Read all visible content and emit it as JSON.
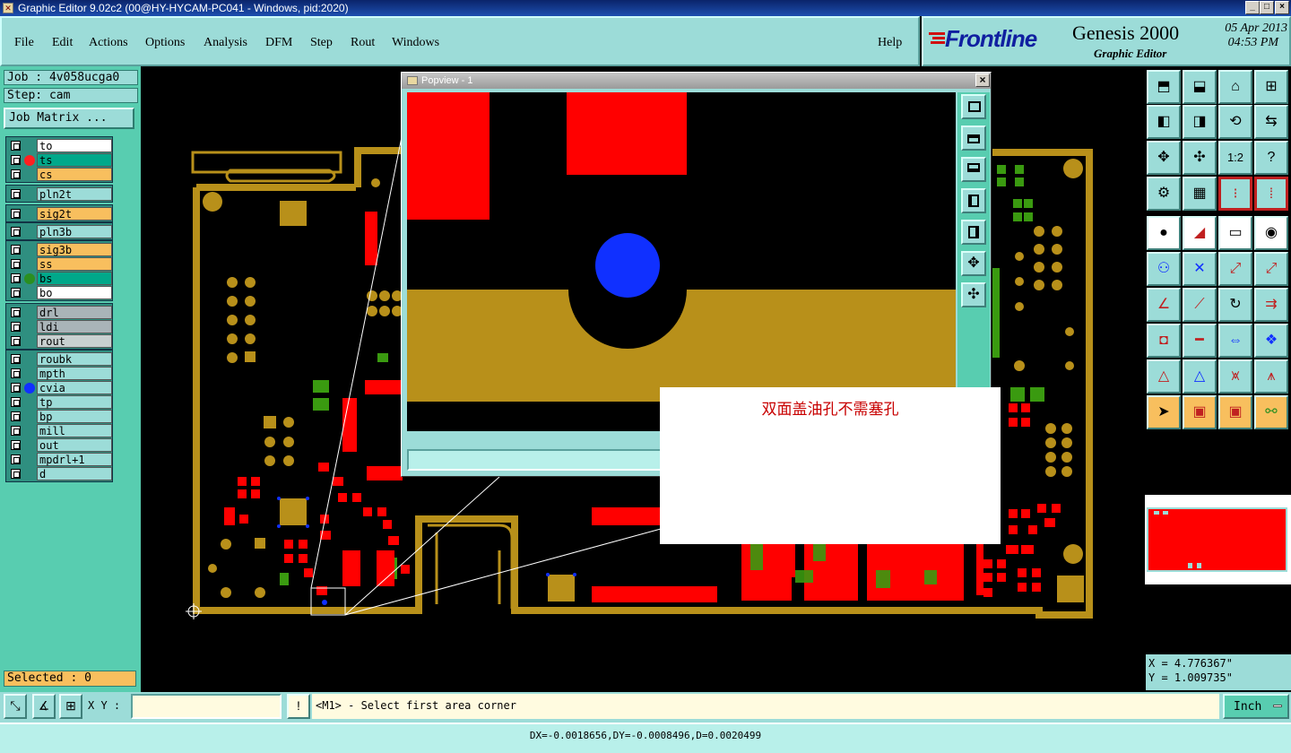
{
  "window": {
    "title": "Graphic Editor 9.02c2 (00@HY-HYCAM-PC041 - Windows, pid:2020)",
    "buttons": [
      "_",
      "□",
      "×"
    ]
  },
  "menu": {
    "items": [
      "File",
      "Edit",
      "Actions",
      "Options",
      "Analysis",
      "DFM",
      "Step",
      "Rout",
      "Windows"
    ],
    "help": "Help"
  },
  "brand": {
    "logo": "Frontline",
    "product": "Genesis 2000",
    "subtitle": "Graphic Editor",
    "date": "05 Apr 2013",
    "time": "04:53 PM"
  },
  "job": {
    "job_label": "Job : 4v058ucga0",
    "step_label": "Step: cam",
    "matrix_button": "Job Matrix ..."
  },
  "layers": [
    {
      "name": "to",
      "bg": "#ffffff",
      "dot": ""
    },
    {
      "name": "ts",
      "bg": "#00a88a",
      "dot": "#ff2020"
    },
    {
      "name": "cs",
      "bg": "#f8bf5e",
      "dot": ""
    },
    {
      "name": "pln2t",
      "bg": "#9cdcd8",
      "dot": ""
    },
    {
      "name": "sig2t",
      "bg": "#f8bf5e",
      "dot": ""
    },
    {
      "name": "pln3b",
      "bg": "#9cdcd8",
      "dot": ""
    },
    {
      "name": "sig3b",
      "bg": "#f8bf5e",
      "dot": ""
    },
    {
      "name": "ss",
      "bg": "#f8bf5e",
      "dot": ""
    },
    {
      "name": "bs",
      "bg": "#00a88a",
      "dot": "#2a8f20"
    },
    {
      "name": "bo",
      "bg": "#ffffff",
      "dot": ""
    },
    {
      "name": "drl",
      "bg": "#a9b4b8",
      "dot": ""
    },
    {
      "name": "ldi",
      "bg": "#a9b4b8",
      "dot": ""
    },
    {
      "name": "rout",
      "bg": "#c8d0d0",
      "dot": ""
    },
    {
      "name": "roubk",
      "bg": "#9cdcd8",
      "dot": ""
    },
    {
      "name": "mpth",
      "bg": "#9cdcd8",
      "dot": ""
    },
    {
      "name": "cvia",
      "bg": "#9cdcd8",
      "dot": "#1030ff"
    },
    {
      "name": "tp",
      "bg": "#9cdcd8",
      "dot": ""
    },
    {
      "name": "bp",
      "bg": "#9cdcd8",
      "dot": ""
    },
    {
      "name": "mill",
      "bg": "#9cdcd8",
      "dot": ""
    },
    {
      "name": "out",
      "bg": "#9cdcd8",
      "dot": ""
    },
    {
      "name": "mpdrl+1",
      "bg": "#9cdcd8",
      "dot": ""
    },
    {
      "name": "d",
      "bg": "#9cdcd8",
      "dot": ""
    }
  ],
  "selected": "Selected : 0",
  "popview": {
    "title": "Popview - 1"
  },
  "annotation": "双面盖油孔不需塞孔",
  "coords": {
    "x": "X = 4.776367\"",
    "y": "Y = 1.009735\""
  },
  "bottom": {
    "xy_label": "X Y :",
    "xy_value": "",
    "prompt": "<M1> - Select first area corner",
    "units": "Inch"
  },
  "status": "DX=-0.0018656,DY=-0.0008496,D=0.0020499",
  "colors": {
    "copper": "#b8901a",
    "pad_red": "#ff0000",
    "pad_green": "#3a9a10",
    "via_blue": "#1030ff",
    "panel_teal": "#9cdcd8"
  }
}
